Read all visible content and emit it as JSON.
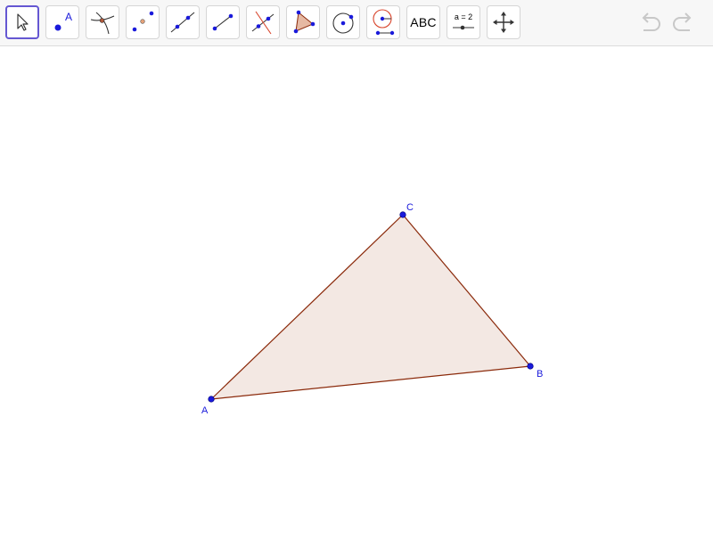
{
  "toolbar": {
    "tools": [
      {
        "name": "move-tool",
        "icon": "arrow-cursor-icon"
      },
      {
        "name": "point-tool",
        "icon": "point-icon",
        "label": "A"
      },
      {
        "name": "intersect-tool",
        "icon": "intersect-icon"
      },
      {
        "name": "midpoint-tool",
        "icon": "midpoint-icon"
      },
      {
        "name": "line-tool",
        "icon": "line-icon"
      },
      {
        "name": "segment-tool",
        "icon": "segment-icon"
      },
      {
        "name": "perpendicular-line-tool",
        "icon": "perpendicular-icon"
      },
      {
        "name": "polygon-tool",
        "icon": "polygon-icon"
      },
      {
        "name": "circle-center-point-tool",
        "icon": "circle-icon"
      },
      {
        "name": "circle-radius-tool",
        "icon": "circle-radius-icon"
      },
      {
        "name": "text-tool",
        "icon": "text-icon",
        "label": "ABC"
      },
      {
        "name": "slider-tool",
        "icon": "slider-icon",
        "label": "a = 2"
      },
      {
        "name": "move-graphics-view-tool",
        "icon": "move-view-icon"
      }
    ],
    "selected_tool": "move-tool",
    "undo_icon": "undo-icon",
    "redo_icon": "redo-icon"
  },
  "canvas": {
    "points": [
      {
        "label": "A"
      },
      {
        "label": "B"
      },
      {
        "label": "C"
      }
    ],
    "polygon_fill": "#f3e8e3",
    "polygon_stroke": "#8b2a0b",
    "point_color": "#1a1adb",
    "label_color": "#1a1adb"
  },
  "colors": {
    "selected_border": "#6557d2",
    "disabled_icon": "#c8c8c8"
  }
}
